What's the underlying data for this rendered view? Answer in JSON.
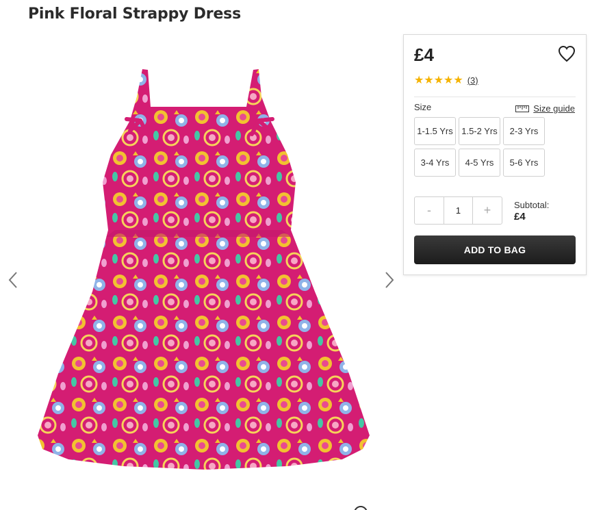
{
  "product": {
    "title": "Pink Floral Strappy Dress",
    "price": "£4",
    "rating": {
      "stars": 5,
      "stars_glyphs": "★★★★★",
      "review_count": "(3)"
    }
  },
  "size": {
    "label": "Size",
    "guide_label": "Size guide",
    "options": [
      "1-1.5 Yrs",
      "1.5-2 Yrs",
      "2-3 Yrs",
      "3-4 Yrs",
      "4-5 Yrs",
      "5-6 Yrs"
    ]
  },
  "quantity": {
    "minus": "-",
    "value": "1",
    "plus": "+"
  },
  "subtotal": {
    "label": "Subtotal:",
    "value": "£4"
  },
  "actions": {
    "add_to_bag": "ADD TO BAG"
  },
  "icons": {
    "wishlist": "heart-icon",
    "size_guide": "ruler-icon",
    "prev": "chevron-left-icon",
    "next": "chevron-right-icon"
  },
  "colors": {
    "dress_pink": "#d81f72",
    "star": "#f5b301",
    "button": "#2a2a2a"
  }
}
